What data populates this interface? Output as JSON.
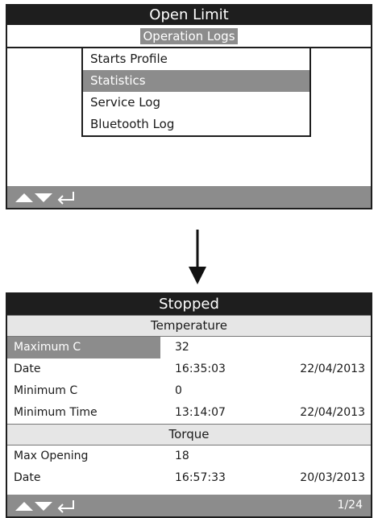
{
  "screen1": {
    "title": "Open Limit",
    "subtitle": "Operation Logs",
    "menu_items": [
      "Starts Profile",
      "Statistics",
      "Service Log",
      "Bluetooth Log"
    ],
    "selected_index": 1
  },
  "icons": {
    "up": "up-triangle-icon",
    "down": "down-triangle-icon",
    "enter": "enter-return-icon",
    "transition": "down-arrow-icon"
  },
  "screen2": {
    "title": "Stopped",
    "sections": [
      {
        "heading": "Temperature",
        "rows": [
          {
            "label": "Maximum C",
            "value": "32",
            "date": ""
          },
          {
            "label": "Date",
            "value": "16:35:03",
            "date": "22/04/2013"
          },
          {
            "label": "Minimum C",
            "value": "0",
            "date": ""
          },
          {
            "label": "Minimum Time",
            "value": "13:14:07",
            "date": "22/04/2013"
          }
        ]
      },
      {
        "heading": "Torque",
        "rows": [
          {
            "label": "Max Opening",
            "value": "18",
            "date": ""
          },
          {
            "label": "Date",
            "value": "16:57:33",
            "date": "20/03/2013"
          }
        ]
      }
    ],
    "page_indicator": "1/24"
  },
  "colors": {
    "title_bar": "#1e1e1e",
    "highlight": "#8c8c8c",
    "section_bg": "#e6e6e6"
  }
}
